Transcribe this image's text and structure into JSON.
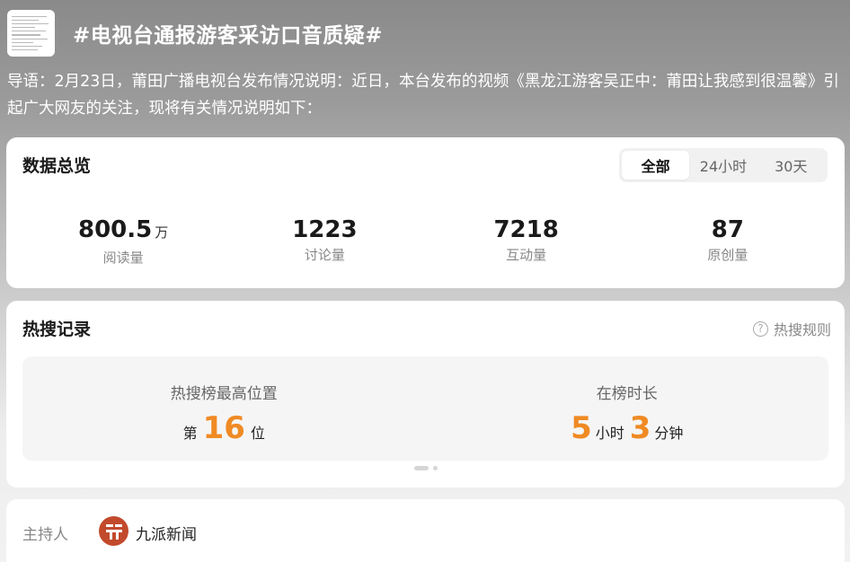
{
  "topic": {
    "title": "#电视台通报游客采访口音质疑#",
    "intro": "导语：2月23日，莆田广播电视台发布情况说明：近日，本台发布的视频《黑龙江游客吴正中：莆田让我感到很温馨》引起广大网友的关注，现将有关情况说明如下："
  },
  "overview": {
    "title": "数据总览",
    "tabs": [
      {
        "label": "全部",
        "active": true
      },
      {
        "label": "24小时",
        "active": false
      },
      {
        "label": "30天",
        "active": false
      }
    ],
    "stats": [
      {
        "value": "800.5",
        "unit": "万",
        "label": "阅读量"
      },
      {
        "value": "1223",
        "unit": "",
        "label": "讨论量"
      },
      {
        "value": "7218",
        "unit": "",
        "label": "互动量"
      },
      {
        "value": "87",
        "unit": "",
        "label": "原创量"
      }
    ]
  },
  "hot_search": {
    "title": "热搜记录",
    "rules_label": "热搜规则",
    "rank": {
      "label": "热搜榜最高位置",
      "prefix": "第",
      "value": "16",
      "suffix": "位"
    },
    "duration": {
      "label": "在榜时长",
      "hours": "5",
      "hours_unit": "小时",
      "minutes": "3",
      "minutes_unit": "分钟"
    },
    "accent_color": "#f08a24"
  },
  "host": {
    "label": "主持人",
    "name": "九派新闻",
    "avatar_color": "#c24a2c"
  }
}
